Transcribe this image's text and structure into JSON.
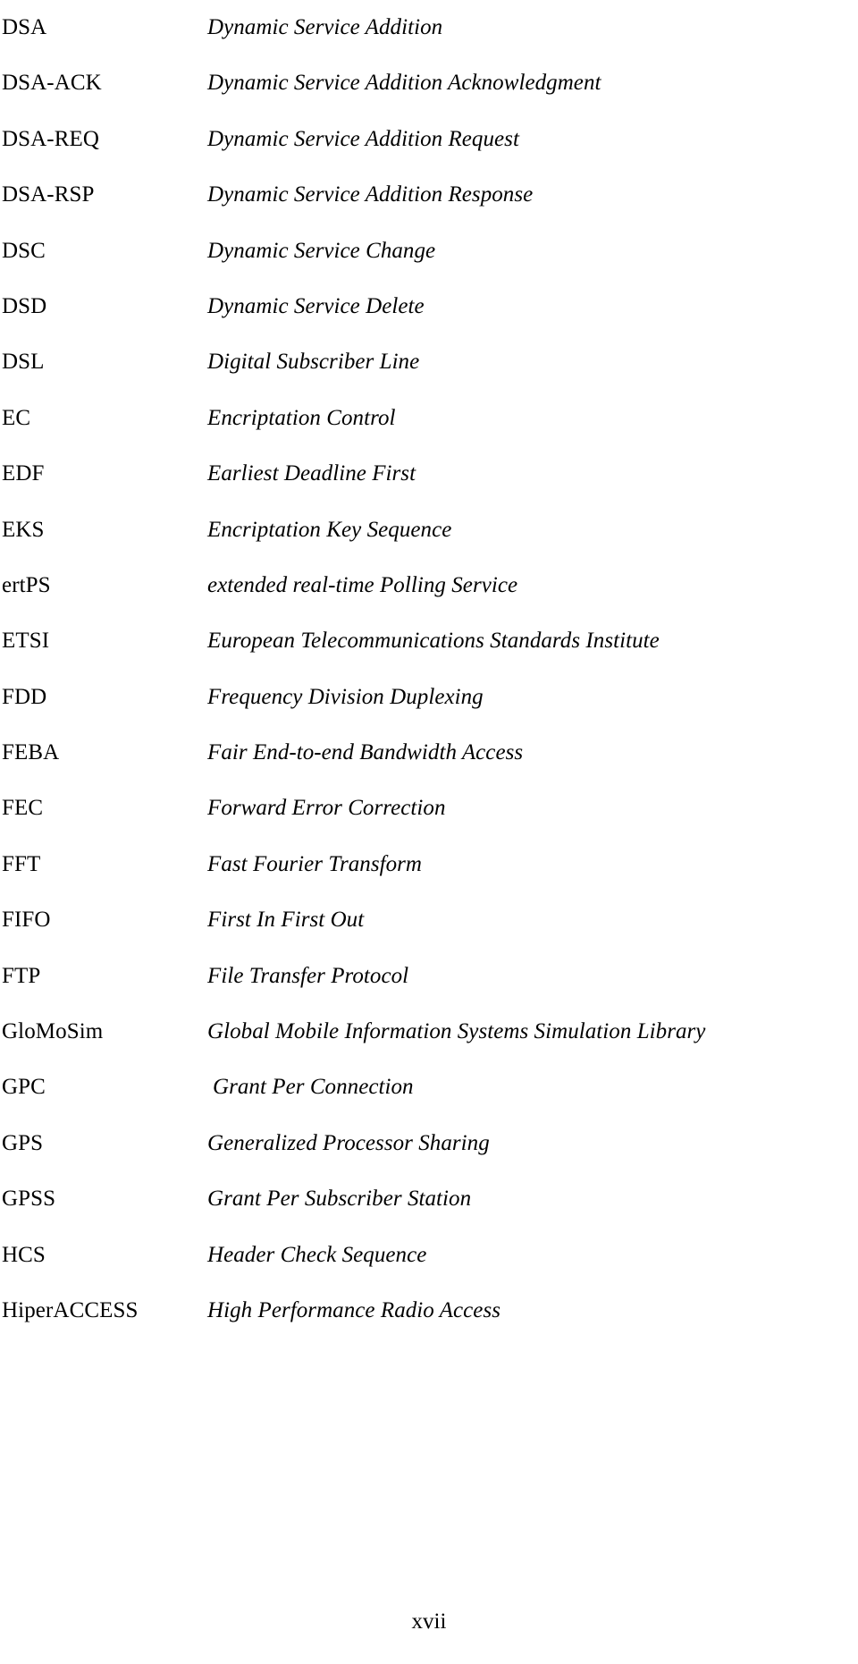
{
  "page": {
    "number_label": "xvii",
    "entries": [
      {
        "abbr": "DSA",
        "expansion": "Dynamic Service Addition",
        "indent": false
      },
      {
        "abbr": "DSA-ACK",
        "expansion": "Dynamic Service Addition Acknowledgment",
        "indent": false
      },
      {
        "abbr": "DSA-REQ",
        "expansion": "Dynamic Service Addition Request",
        "indent": false
      },
      {
        "abbr": "DSA-RSP",
        "expansion": "Dynamic Service Addition Response",
        "indent": false
      },
      {
        "abbr": "DSC",
        "expansion": "Dynamic Service Change",
        "indent": false
      },
      {
        "abbr": "DSD",
        "expansion": "Dynamic Service Delete",
        "indent": false
      },
      {
        "abbr": "DSL",
        "expansion": "Digital Subscriber Line",
        "indent": false
      },
      {
        "abbr": "EC",
        "expansion": "Encriptation Control",
        "indent": false
      },
      {
        "abbr": "EDF",
        "expansion": "Earliest Deadline First",
        "indent": false
      },
      {
        "abbr": "EKS",
        "expansion": "Encriptation Key Sequence",
        "indent": false
      },
      {
        "abbr": "ertPS",
        "expansion": "extended real-time Polling Service",
        "indent": false
      },
      {
        "abbr": "ETSI",
        "expansion": "European Telecommunications Standards Institute",
        "indent": false
      },
      {
        "abbr": "FDD",
        "expansion": "Frequency Division Duplexing",
        "indent": false
      },
      {
        "abbr": "FEBA",
        "expansion": "Fair End-to-end Bandwidth Access",
        "indent": false
      },
      {
        "abbr": "FEC",
        "expansion": "Forward Error Correction",
        "indent": false
      },
      {
        "abbr": "FFT",
        "expansion": "Fast Fourier Transform",
        "indent": false
      },
      {
        "abbr": "FIFO",
        "expansion": "First In First Out",
        "indent": false
      },
      {
        "abbr": "FTP",
        "expansion": "File Transfer Protocol",
        "indent": false
      },
      {
        "abbr": "GloMoSim",
        "expansion": "Global Mobile Information Systems Simulation Library",
        "indent": false
      },
      {
        "abbr": "GPC",
        "expansion": "Grant Per Connection",
        "indent": true
      },
      {
        "abbr": "GPS",
        "expansion": "Generalized Processor Sharing",
        "indent": false
      },
      {
        "abbr": "GPSS",
        "expansion": "Grant Per Subscriber Station",
        "indent": false
      },
      {
        "abbr": "HCS",
        "expansion": "Header Check Sequence",
        "indent": false
      },
      {
        "abbr": "HiperACCESS",
        "expansion": "High Performance Radio Access",
        "indent": false
      }
    ]
  }
}
